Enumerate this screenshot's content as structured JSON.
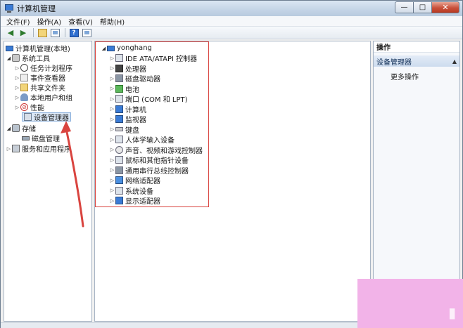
{
  "window": {
    "title": "计算机管理",
    "controls": {
      "minimize": "—",
      "maximize": "□",
      "close": "✕"
    }
  },
  "menu": [
    {
      "label": "文件(F)"
    },
    {
      "label": "操作(A)"
    },
    {
      "label": "查看(V)"
    },
    {
      "label": "帮助(H)"
    }
  ],
  "left_tree": {
    "root": "计算机管理(本地)",
    "system_tools": "系统工具",
    "items": [
      {
        "label": "任务计划程序"
      },
      {
        "label": "事件查看器"
      },
      {
        "label": "共享文件夹"
      },
      {
        "label": "本地用户和组"
      },
      {
        "label": "性能"
      },
      {
        "label": "设备管理器"
      }
    ],
    "storage": "存储",
    "disk_mgmt": "磁盘管理",
    "services": "服务和应用程序"
  },
  "device_tree": {
    "computer": "yonghang",
    "devices": [
      {
        "label": "IDE ATA/ATAPI 控制器",
        "icon": "ide-controller-icon"
      },
      {
        "label": "处理器",
        "icon": "processor-icon"
      },
      {
        "label": "磁盘驱动器",
        "icon": "disk-drive-icon"
      },
      {
        "label": "电池",
        "icon": "battery-icon"
      },
      {
        "label": "端口 (COM 和 LPT)",
        "icon": "port-icon"
      },
      {
        "label": "计算机",
        "icon": "computer-icon"
      },
      {
        "label": "监视器",
        "icon": "monitor-icon"
      },
      {
        "label": "键盘",
        "icon": "keyboard-icon"
      },
      {
        "label": "人体学输入设备",
        "icon": "hid-icon"
      },
      {
        "label": "声音、视频和游戏控制器",
        "icon": "audio-icon"
      },
      {
        "label": "鼠标和其他指针设备",
        "icon": "mouse-icon"
      },
      {
        "label": "通用串行总线控制器",
        "icon": "usb-icon"
      },
      {
        "label": "网络适配器",
        "icon": "network-adapter-icon"
      },
      {
        "label": "系统设备",
        "icon": "system-device-icon"
      },
      {
        "label": "显示适配器",
        "icon": "display-adapter-icon"
      }
    ]
  },
  "actions": {
    "header": "操作",
    "section": "设备管理器",
    "more": "更多操作"
  },
  "colors": {
    "highlight": "#d9443f",
    "arrow": "#d9443f",
    "watermark": "#f2b3e8"
  }
}
